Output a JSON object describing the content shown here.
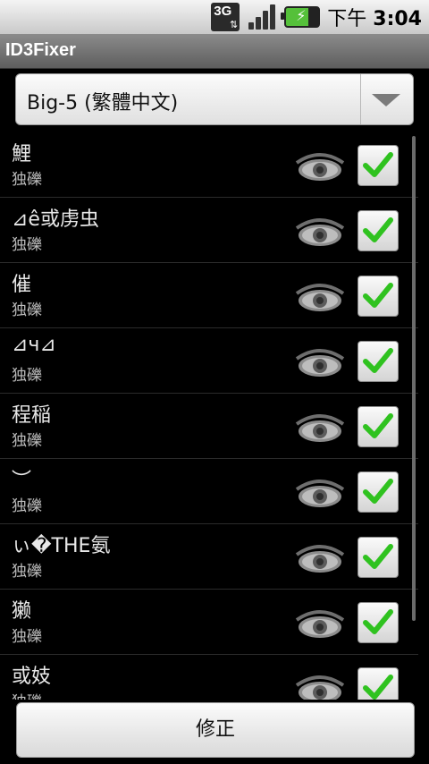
{
  "statusbar": {
    "network_label": "3G",
    "time_prefix": "下午",
    "time": "3:04"
  },
  "app": {
    "title": "ID3Fixer"
  },
  "spinner": {
    "selected": "Big-5 (繁體中文)"
  },
  "items": [
    {
      "title": "鯉",
      "subtitle": "独礫",
      "checked": true
    },
    {
      "title": "⊿ê或虏虫",
      "subtitle": "独礫",
      "checked": true
    },
    {
      "title": "催",
      "subtitle": "独礫",
      "checked": true
    },
    {
      "title": "⊿ч⊿",
      "subtitle": "独礫",
      "checked": true
    },
    {
      "title": "程稲",
      "subtitle": "独礫",
      "checked": true
    },
    {
      "title": "︶",
      "subtitle": "独礫",
      "checked": true
    },
    {
      "title": "ぃ�THE氨",
      "subtitle": "独礫",
      "checked": true
    },
    {
      "title": "獭",
      "subtitle": "独礫",
      "checked": true
    },
    {
      "title": "或妓",
      "subtitle": "独礫",
      "checked": true
    }
  ],
  "actions": {
    "fix_label": "修正"
  },
  "colors": {
    "check": "#2fc21f",
    "eye": "#8c8c8c"
  }
}
